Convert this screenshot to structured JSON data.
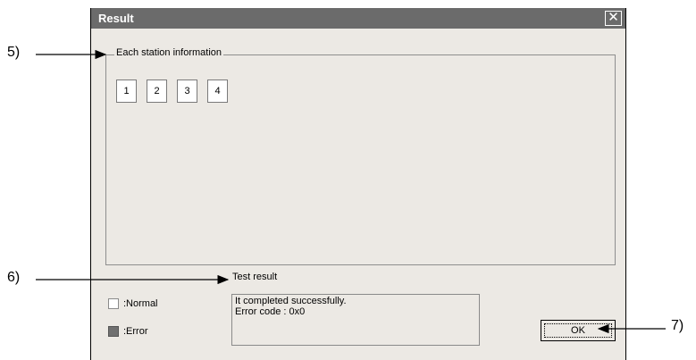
{
  "dialog": {
    "title": "Result",
    "close_glyph": "✕",
    "group_label": "Each station information",
    "stations": [
      "1",
      "2",
      "3",
      "4"
    ],
    "test_result_label": "Test result",
    "legend": [
      {
        "label": ":Normal"
      },
      {
        "label": ":Error"
      }
    ],
    "result_line1": "It completed successfully.",
    "result_line2": "Error code : 0x0",
    "ok_label": "OK"
  },
  "callouts": {
    "c5": "5)",
    "c6": "6)",
    "c7": "7)"
  }
}
